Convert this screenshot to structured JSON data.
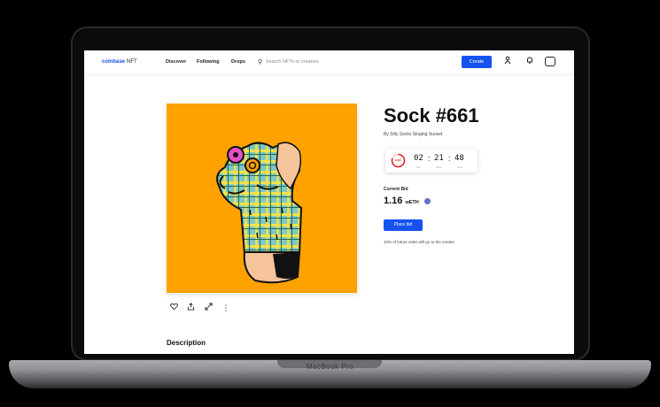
{
  "device": {
    "label": "MacBook Pro"
  },
  "nav": {
    "logo_brand": "coinbase",
    "logo_suffix": "NFT",
    "links": [
      "Discover",
      "Following",
      "Drops"
    ],
    "search_placeholder": "Search NFTs or creators",
    "create_label": "Create",
    "icons": [
      "user-icon",
      "bell-icon",
      "avatar-icon"
    ]
  },
  "nft": {
    "title": "Sock #661",
    "by_line": "By Silly Socks Singing Sunset",
    "timer": {
      "status": "Live",
      "hours": "02",
      "minutes": "21",
      "seconds": "48",
      "hours_unit": "hrs",
      "minutes_unit": "mins",
      "seconds_unit": "secs"
    },
    "current_bid_label": "Current Bid",
    "current_bid_value": "1.16",
    "current_bid_unit": "wETH",
    "place_bid_label": "Place bid",
    "royalty_note": "10% of future sales will go to the creator",
    "actions": [
      "heart-icon",
      "share-icon",
      "expand-icon",
      "more-icon"
    ]
  },
  "description_title": "Description",
  "colors": {
    "accent": "#1652f0",
    "art_background": "#ffa200",
    "timer_ring": "#dd2222"
  }
}
